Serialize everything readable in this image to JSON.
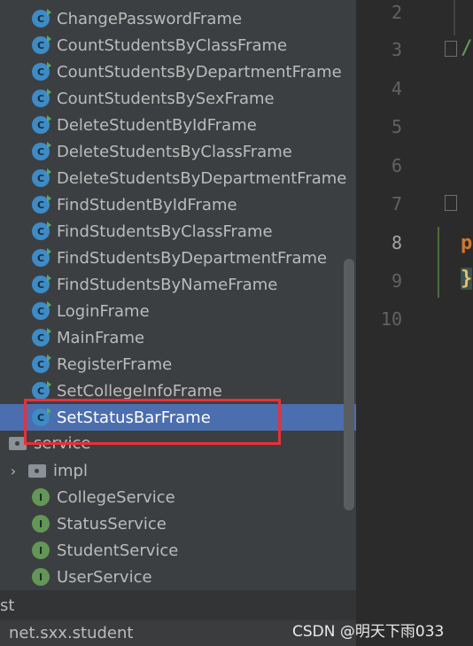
{
  "project_tree": {
    "frames": [
      "ChangePasswordFrame",
      "CountStudentsByClassFrame",
      "CountStudentsByDepartmentFrame",
      "CountStudentsBySexFrame",
      "DeleteStudentByIdFrame",
      "DeleteStudentsByClassFrame",
      "DeleteStudentsByDepartmentFrame",
      "FindStudentByIdFrame",
      "FindStudentsByClassFrame",
      "FindStudentsByDepartmentFrame",
      "FindStudentsByNameFrame",
      "LoginFrame",
      "MainFrame",
      "RegisterFrame",
      "SetCollegeInfoFrame",
      "SetStatusBarFrame"
    ],
    "class_icon_letter": "C",
    "service_folder": "service",
    "impl_folder": "impl",
    "interfaces": [
      "CollegeService",
      "StatusService",
      "StudentService",
      "UserService"
    ],
    "interface_icon_letter": "I",
    "test_label": "st",
    "package_label": "net.sxx.student"
  },
  "editor": {
    "line_numbers": [
      "2",
      "3",
      "4",
      "5",
      "6",
      "7",
      "8",
      "9",
      "10"
    ],
    "code_line_3": "/",
    "code_line_8": "p",
    "code_line_9": "}"
  },
  "colors": {
    "selection": "#4b6eaf",
    "highlight_box": "#e8303a",
    "class_icon": "#3d8bc7",
    "interface_icon": "#629755"
  },
  "watermark": "CSDN @明天下雨033"
}
